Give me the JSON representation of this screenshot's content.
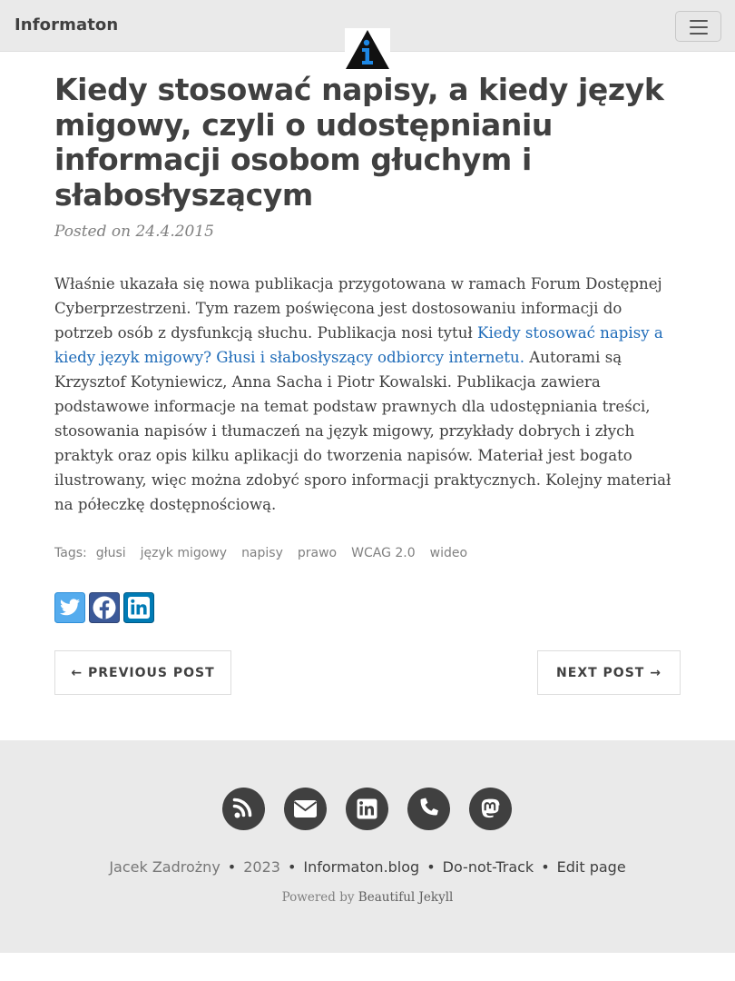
{
  "navbar": {
    "brand": "Informaton",
    "menu_icon": "hamburger-menu-icon",
    "logo_icon": "info-triangle-logo-icon"
  },
  "post": {
    "title": "Kiedy stosować napisy, a kiedy język migowy, czyli o udostępnianiu informacji osobom głuchym i słabosłyszącym",
    "meta": "Posted on 24.4.2015",
    "body_before_link": "Właśnie ukazała się nowa publikacja przygotowana w ramach Forum Dostępnej Cyberprzestrzeni. Tym razem poświęcona jest dostosowaniu informacji do potrzeb osób z dysfunkcją słuchu. Publikacja nosi tytuł ",
    "body_link": "Kiedy stosować napisy a kiedy język migowy? Głusi i słabosłyszący odbiorcy internetu.",
    "body_after_link": " Autorami są Krzysztof Kotyniewicz, Anna Sacha i Piotr Kowalski. Publikacja zawiera podstawowe informacje na temat podstaw prawnych dla udostępniania treści, stosowania napisów i tłumaczeń na język migowy, przykłady dobrych i złych praktyk oraz opis kilku aplikacji do tworzenia napisów. Materiał jest bogato ilustrowany, więc można zdobyć sporo informacji praktycznych. Kolejny materiał na półeczkę dostępnościową.",
    "tags_label": "Tags:",
    "tags": [
      "głusi",
      "język migowy",
      "napisy",
      "prawo",
      "WCAG 2.0",
      "wideo"
    ]
  },
  "share": {
    "twitter_icon": "twitter-icon",
    "facebook_icon": "facebook-icon",
    "linkedin_icon": "linkedin-icon"
  },
  "pager": {
    "previous": "← PREVIOUS POST",
    "next": "NEXT POST →"
  },
  "footer": {
    "icons": [
      "rss-icon",
      "envelope-icon",
      "linkedin-icon",
      "phone-icon",
      "mastodon-icon"
    ],
    "author": "Jacek Zadrożny",
    "sep": "•",
    "year": "2023",
    "site": "Informaton.blog",
    "dnt": "Do-not-Track",
    "edit": "Edit page",
    "powered_prefix": "Powered by ",
    "powered_link": "Beautiful Jekyll"
  },
  "colors": {
    "navbar_bg": "#eaeaea",
    "text": "#404040",
    "link": "#1e6bb8",
    "twitter": "#55acee",
    "facebook": "#3b5998",
    "linkedin": "#007bb5",
    "logo_blue": "#1e88e5"
  }
}
